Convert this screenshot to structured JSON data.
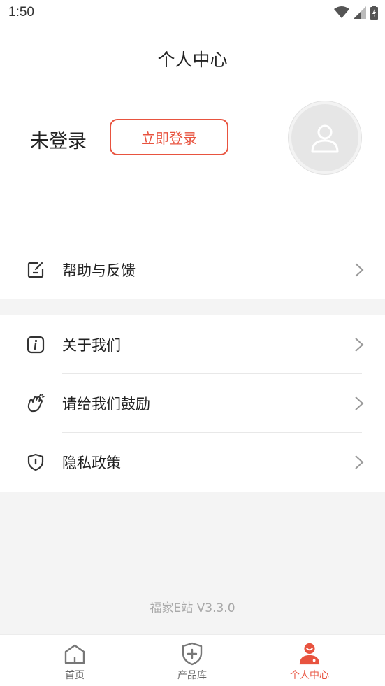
{
  "status_bar": {
    "time": "1:50"
  },
  "header": {
    "title": "个人中心"
  },
  "account": {
    "status_text": "未登录",
    "login_label": "立即登录"
  },
  "menu": {
    "group1": [
      {
        "label": "帮助与反馈",
        "icon": "edit-icon"
      }
    ],
    "group2": [
      {
        "label": "关于我们",
        "icon": "info-icon"
      },
      {
        "label": "请给我们鼓励",
        "icon": "clap-icon"
      },
      {
        "label": "隐私政策",
        "icon": "shield-icon"
      }
    ]
  },
  "footer": {
    "version": "福家E站 V3.3.0"
  },
  "tabs": [
    {
      "label": "首页",
      "icon": "home-icon",
      "active": false
    },
    {
      "label": "产品库",
      "icon": "shield-plus-icon",
      "active": false
    },
    {
      "label": "个人中心",
      "icon": "person-icon",
      "active": true
    }
  ],
  "colors": {
    "accent": "#e8533f",
    "background_gray": "#f4f4f4"
  }
}
